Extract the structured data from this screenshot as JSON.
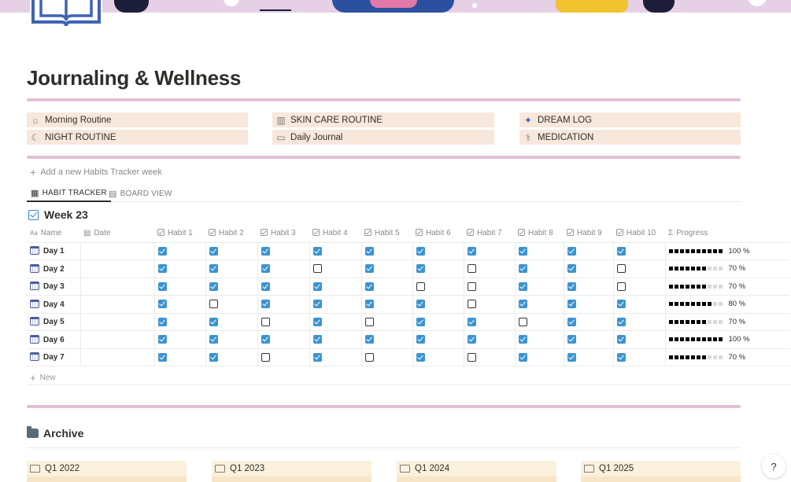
{
  "page": {
    "title": "Journaling & Wellness"
  },
  "links": [
    {
      "label": "Morning Routine",
      "icon": "sun-icon"
    },
    {
      "label": "SKIN CARE ROUTINE",
      "icon": "lotion-icon"
    },
    {
      "label": "DREAM LOG",
      "icon": "sparkle-icon"
    },
    {
      "label": "NIGHT ROUTINE",
      "icon": "moon-icon"
    },
    {
      "label": "Daily Journal",
      "icon": "book-icon"
    },
    {
      "label": "MEDICATION",
      "icon": "pill-icon"
    }
  ],
  "add_week": "Add a new Habits Tracker week",
  "tabs": [
    {
      "label": "HABIT TRACKER",
      "icon": "table-icon",
      "active": true
    },
    {
      "label": "BOARD VIEW",
      "icon": "board-icon",
      "active": false
    }
  ],
  "week_title": "Week 23",
  "table": {
    "headers": {
      "name": "Name",
      "date": "Date",
      "habits": [
        "Habit 1",
        "Habit 2",
        "Habit 3",
        "Habit 4",
        "Habit 5",
        "Habit 6",
        "Habit 7",
        "Habit 8",
        "Habit 9",
        "Habit 10"
      ],
      "progress": "Progress"
    },
    "rows": [
      {
        "name": "Day 1",
        "date": "",
        "habits": [
          true,
          true,
          true,
          true,
          true,
          true,
          true,
          true,
          true,
          true
        ],
        "progress": 1.0,
        "progress_label": "100 %"
      },
      {
        "name": "Day 2",
        "date": "",
        "habits": [
          true,
          true,
          true,
          false,
          true,
          true,
          false,
          true,
          true,
          false
        ],
        "progress": 0.7,
        "progress_label": "70 %"
      },
      {
        "name": "Day 3",
        "date": "",
        "habits": [
          true,
          true,
          true,
          true,
          true,
          false,
          false,
          true,
          true,
          false
        ],
        "progress": 0.7,
        "progress_label": "70 %"
      },
      {
        "name": "Day 4",
        "date": "",
        "habits": [
          true,
          false,
          true,
          true,
          true,
          true,
          false,
          true,
          true,
          true
        ],
        "progress": 0.8,
        "progress_label": "80 %"
      },
      {
        "name": "Day 5",
        "date": "",
        "habits": [
          true,
          true,
          false,
          true,
          false,
          true,
          true,
          false,
          true,
          true
        ],
        "progress": 0.7,
        "progress_label": "70 %"
      },
      {
        "name": "Day 6",
        "date": "",
        "habits": [
          true,
          true,
          true,
          true,
          true,
          true,
          true,
          true,
          true,
          true
        ],
        "progress": 1.0,
        "progress_label": "100 %"
      },
      {
        "name": "Day 7",
        "date": "",
        "habits": [
          true,
          true,
          false,
          true,
          false,
          true,
          false,
          true,
          true,
          true
        ],
        "progress": 0.7,
        "progress_label": "70 %"
      }
    ],
    "new_label": "New"
  },
  "archive": {
    "title": "Archive",
    "cards": [
      "Q1 2022",
      "Q1 2023",
      "Q1 2024",
      "Q1 2025"
    ]
  },
  "help_label": "?",
  "colors": {
    "accent_check": "#3b94d0",
    "divider_pink": "#e2bfd9",
    "link_bg": "#f7e8db",
    "card_bg": "#fbf1dc"
  }
}
